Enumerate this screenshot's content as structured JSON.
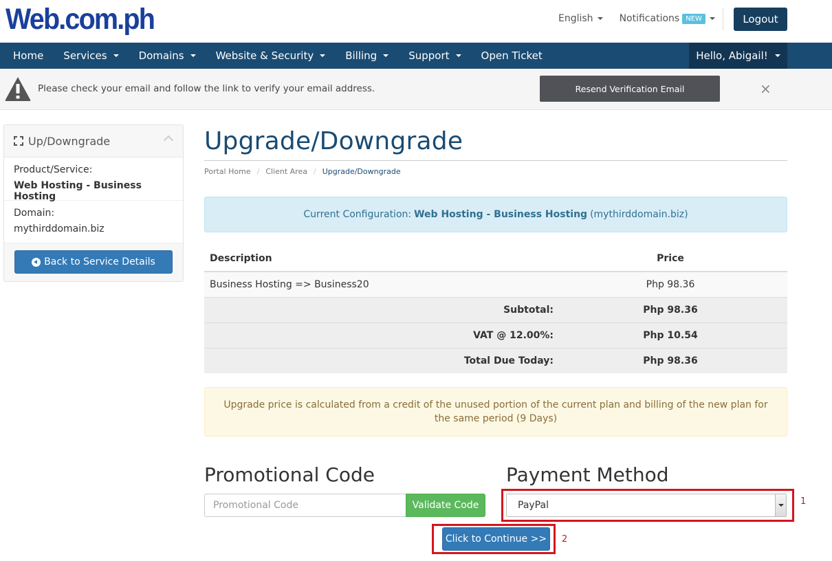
{
  "header": {
    "logo_text": "Web.com.ph",
    "language": "English",
    "notifications": "Notifications",
    "new_badge": "NEW",
    "logout": "Logout"
  },
  "navbar": {
    "items": [
      {
        "label": "Home",
        "dropdown": false
      },
      {
        "label": "Services",
        "dropdown": true
      },
      {
        "label": "Domains",
        "dropdown": true
      },
      {
        "label": "Website & Security",
        "dropdown": true
      },
      {
        "label": "Billing",
        "dropdown": true
      },
      {
        "label": "Support",
        "dropdown": true
      },
      {
        "label": "Open Ticket",
        "dropdown": false
      }
    ],
    "user_greeting": "Hello, Abigail!"
  },
  "verify_alert": {
    "message": "Please check your email and follow the link to verify your email address.",
    "resend_label": "Resend Verification Email",
    "close_glyph": "×"
  },
  "sidebar": {
    "title": "Up/Downgrade",
    "product_label": "Product/Service:",
    "product_value": "Web Hosting - Business Hosting",
    "domain_label": "Domain:",
    "domain_value": "mythirddomain.biz",
    "back_button": "Back to Service Details"
  },
  "main": {
    "title": "Upgrade/Downgrade",
    "breadcrumb": [
      "Portal Home",
      "Client Area",
      "Upgrade/Downgrade"
    ],
    "current_config_prefix": "Current Configuration:",
    "current_config_product": "Web Hosting - Business Hosting",
    "current_config_domain": "(mythirddomain.biz)",
    "table": {
      "headers": {
        "description": "Description",
        "price": "Price"
      },
      "item": {
        "description": "Business Hosting => Business20",
        "price": "Php 98.36"
      },
      "subtotal": {
        "label": "Subtotal:",
        "value": "Php 98.36"
      },
      "vat": {
        "label": "VAT @ 12.00%:",
        "value": "Php 10.54"
      },
      "total": {
        "label": "Total Due Today:",
        "value": "Php 98.36"
      }
    },
    "note": "Upgrade price is calculated from a credit of the unused portion of the current plan and billing of the new plan for the same period (9 Days)",
    "promo": {
      "heading": "Promotional Code",
      "placeholder": "Promotional Code",
      "validate_label": "Validate Code"
    },
    "payment": {
      "heading": "Payment Method",
      "selected": "PayPal"
    },
    "continue_label": "Click to Continue >>"
  },
  "annotations": {
    "box1_number": "1",
    "box2_number": "2",
    "color": "#d4141c"
  },
  "colors": {
    "navbar": "#1a4b72",
    "accent_blue": "#337ab7",
    "success_green": "#5cb85c",
    "logo_blue": "#1a3f9c"
  }
}
